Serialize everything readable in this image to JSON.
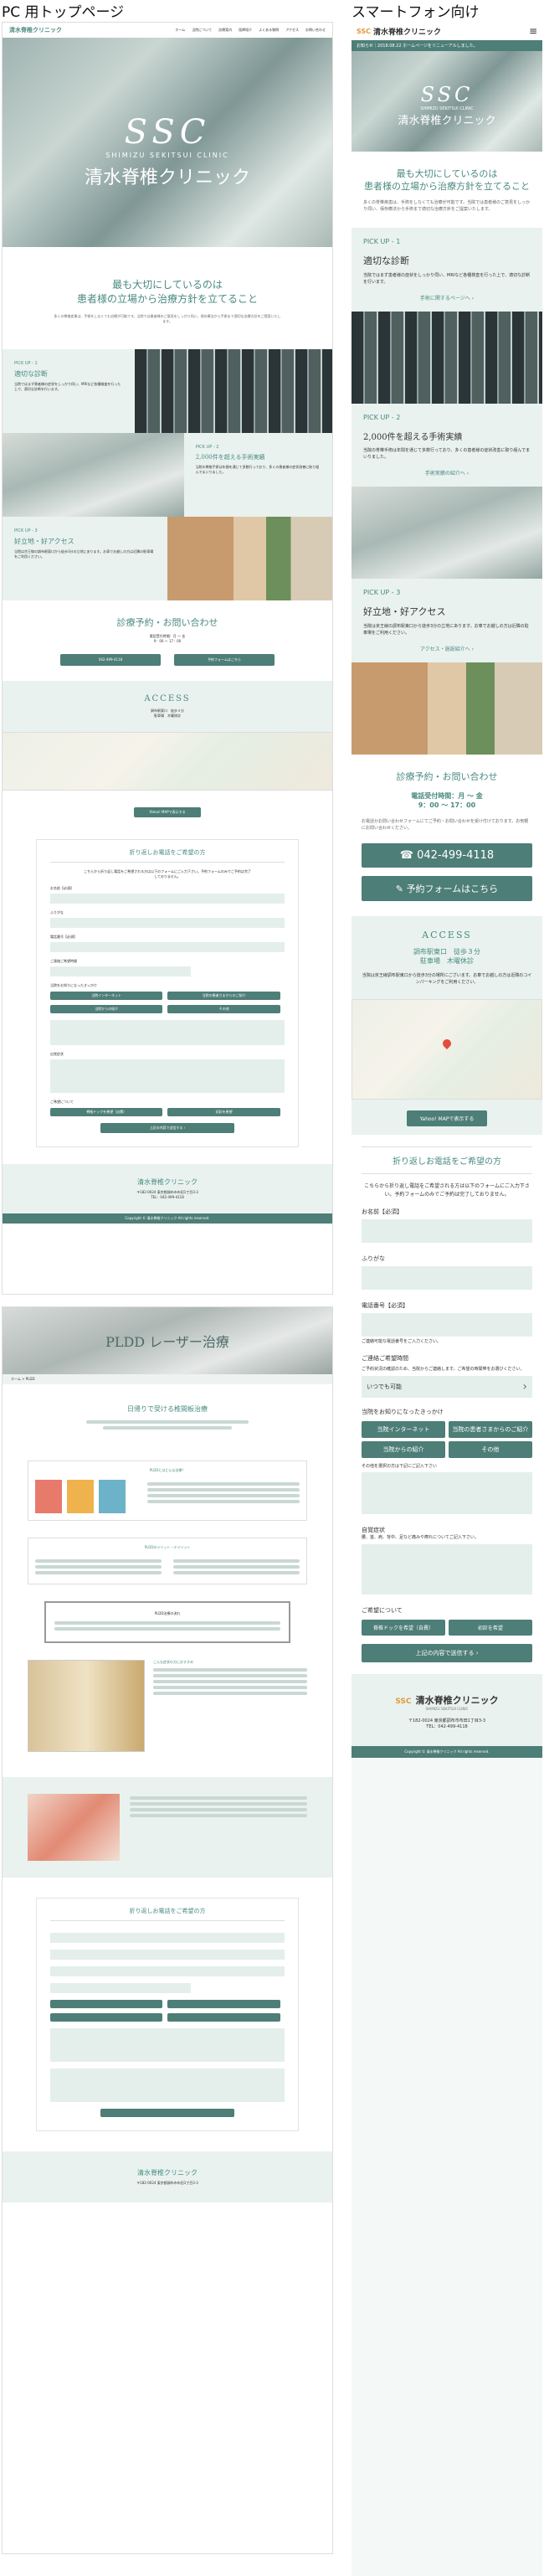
{
  "labels": {
    "pc": "PC 用トップページ",
    "sp": "スマートフォン向け"
  },
  "brand": {
    "name": "清水脊椎クリニック",
    "name_en": "SHIMIZU SEKITSUI CLINIC",
    "logo_mark": "SSC"
  },
  "pc_nav": [
    "ホーム",
    "当院について",
    "診療案内",
    "医師紹介",
    "よくある質問",
    "アクセス",
    "お問い合わせ"
  ],
  "hero": {
    "title": "清水脊椎クリニック",
    "tagline": "SHIMIZU SEKITSUI CLINIC"
  },
  "intro": {
    "lead1": "最も大切にしているのは",
    "lead2": "患者様の立場から治療方針を立てること",
    "body": "多くの脊椎疾患は、手術をしなくても治療が可能です。当院では患者様のご意見をしっかり伺い、保存療法から手術まで適切な治療方針をご提案いたします。"
  },
  "picks": [
    {
      "tag": "PICK UP - 1",
      "title": "適切な診断",
      "body": "当院ではまず患者様の症状をしっかり伺い、MRIなど各種検査を行った上で、適切な診断を行います。",
      "link": "手術に関するページへ ›"
    },
    {
      "tag": "PICK UP - 2",
      "title": "2,000件を超える手術実績",
      "body": "当院の脊椎手術は年間を通じて多数行っており、多くの患者様の症状改善に取り組んでまいりました。",
      "link": "手術実績の紹介へ ›"
    },
    {
      "tag": "PICK UP - 3",
      "title": "好立地・好アクセス",
      "body": "当院は京王線の調布駅東口から徒歩3分の立地にあります。お車でお越しの方は近隣の駐車場をご利用ください。",
      "link": "アクセス・施設紹介へ ›"
    }
  ],
  "contact": {
    "title": "診療予約・お問い合わせ",
    "hours_label": "電話受付時間：月 ～ 金",
    "hours": "9：00 ～ 17：00",
    "note": "お電話かお問い合わせフォームにてご予約・お問い合わせを受け付けております。お気軽にお問い合わせください。",
    "phone": "042-499-4118",
    "form_btn": "予約フォームはこちら"
  },
  "access": {
    "title": "ACCESS",
    "station": "調布駅東口　徒歩３分",
    "closed": "駐車場　木曜休診",
    "body": "当院は京王線調布駅東口から徒歩3分の場所にございます。お車でお越しの方は近隣のコインパーキングをご利用ください。",
    "map_btn": "Yahoo! MAPで表示する"
  },
  "form": {
    "title": "折り返しお電話をご希望の方",
    "intro": "こちらから折り返し電話をご希望される方は以下のフォームにご入力下さい。予約フォームのみでご予約は完了しておりません。",
    "name": "お名前【必須】",
    "kana": "ふりがな",
    "tel": "電話番号【必須】",
    "tel_note": "ご連絡可能な電話番号をご入力ください。",
    "time": "ご連絡ご希望時間",
    "time_note": "ご予約状況の確認のため、当院からご連絡します。ご希望の時間帯をお選びください。",
    "time_select": "いつでも可能",
    "source": "当院をお知りになったきっかけ",
    "source_opts": [
      "当院インターネット",
      "当院の患者さまからのご紹介",
      "当院からの紹介",
      "その他"
    ],
    "other": "その他を選択の方は下記にご記入下さい",
    "symptom": "自覚症状",
    "symptom_note": "腰、首、肩、背中、足など痛みや痺れについてご記入下さい。",
    "req": "ご希望について",
    "req_opts": [
      "脊椎ドックを希望（自費）",
      "初診を希望"
    ],
    "submit": "上記の内容で送信する ›"
  },
  "footer": {
    "addr": "〒182-0024 東京都調布市布田1丁目3-3",
    "tel": "TEL：042-499-4118",
    "copyright": "Copyright © 清水脊椎クリニック All rights reserved."
  },
  "pldd": {
    "title": "PLDD レーザー治療",
    "breadcrumb": "ホーム > PLDD",
    "lead": "日帰りで受ける椎間板治療",
    "card1": "PLDDとはどんな治療？",
    "card2": "PLDDのメリット・デメリット",
    "card3": "PLDD治療の流れ",
    "card4": "こんな症状の方におすすめ"
  },
  "sp_banner": "お知らせ｜2018.08.22 ホームページをリニューアルしました。",
  "sp_menu_icon": "≡"
}
